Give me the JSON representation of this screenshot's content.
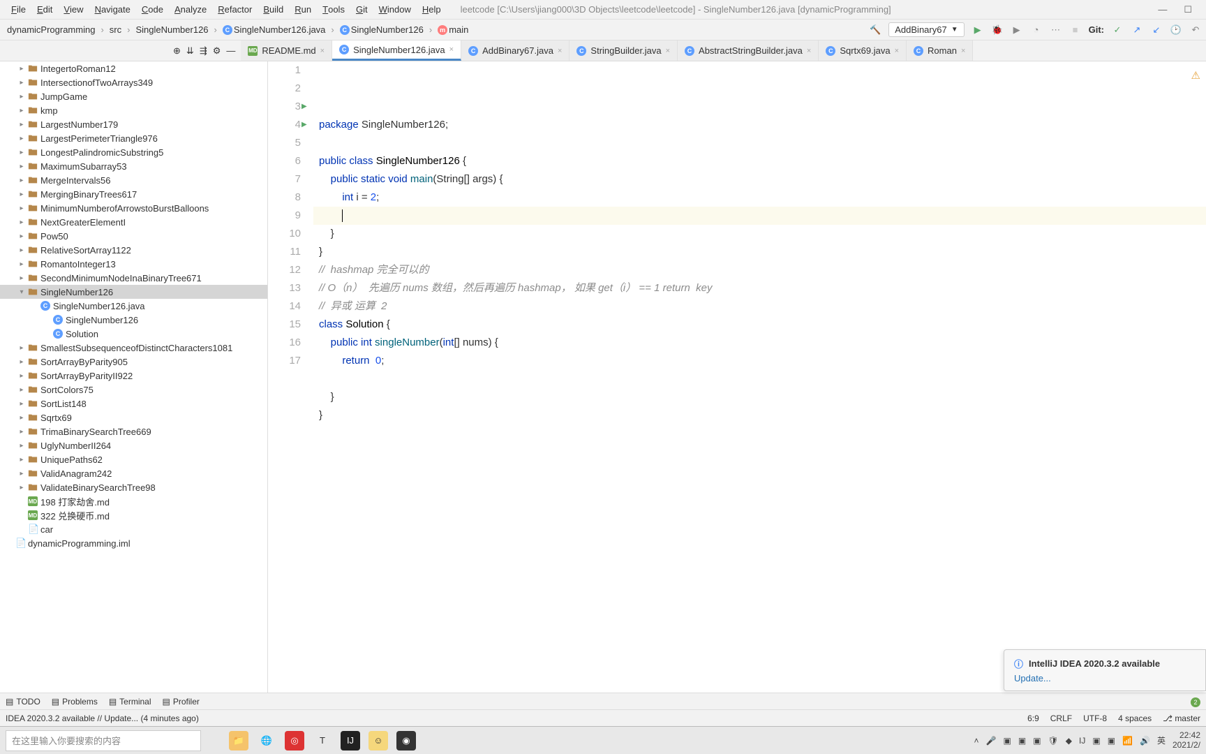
{
  "window": {
    "title": "leetcode [C:\\Users\\jiang000\\3D Objects\\leetcode\\leetcode] - SingleNumber126.java [dynamicProgramming]"
  },
  "menu": [
    "File",
    "Edit",
    "View",
    "Navigate",
    "Code",
    "Analyze",
    "Refactor",
    "Build",
    "Run",
    "Tools",
    "Git",
    "Window",
    "Help"
  ],
  "breadcrumb": [
    {
      "label": "dynamicProgramming",
      "icon": ""
    },
    {
      "label": "src",
      "icon": ""
    },
    {
      "label": "SingleNumber126",
      "icon": ""
    },
    {
      "label": "SingleNumber126.java",
      "icon": "c"
    },
    {
      "label": "SingleNumber126",
      "icon": "c"
    },
    {
      "label": "main",
      "icon": "m"
    }
  ],
  "run_config": "AddBinary67",
  "git_label": "Git:",
  "tabs": [
    {
      "label": "README.md",
      "icon": "md",
      "active": false
    },
    {
      "label": "SingleNumber126.java",
      "icon": "c",
      "active": true
    },
    {
      "label": "AddBinary67.java",
      "icon": "c",
      "active": false
    },
    {
      "label": "StringBuilder.java",
      "icon": "c",
      "active": false
    },
    {
      "label": "AbstractStringBuilder.java",
      "icon": "c",
      "active": false
    },
    {
      "label": "Sqrtx69.java",
      "icon": "c",
      "active": false
    },
    {
      "label": "Roman",
      "icon": "c",
      "active": false
    }
  ],
  "tree": [
    {
      "label": "IntegertoRoman12",
      "depth": 1,
      "icon": "fold"
    },
    {
      "label": "IntersectionofTwoArrays349",
      "depth": 1,
      "icon": "fold"
    },
    {
      "label": "JumpGame",
      "depth": 1,
      "icon": "fold"
    },
    {
      "label": "kmp",
      "depth": 1,
      "icon": "fold"
    },
    {
      "label": "LargestNumber179",
      "depth": 1,
      "icon": "fold"
    },
    {
      "label": "LargestPerimeterTriangle976",
      "depth": 1,
      "icon": "fold"
    },
    {
      "label": "LongestPalindromicSubstring5",
      "depth": 1,
      "icon": "fold"
    },
    {
      "label": "MaximumSubarray53",
      "depth": 1,
      "icon": "fold"
    },
    {
      "label": "MergeIntervals56",
      "depth": 1,
      "icon": "fold"
    },
    {
      "label": "MergingBinaryTrees617",
      "depth": 1,
      "icon": "fold"
    },
    {
      "label": "MinimumNumberofArrowstoBurstBalloons",
      "depth": 1,
      "icon": "fold"
    },
    {
      "label": "NextGreaterElementI",
      "depth": 1,
      "icon": "fold"
    },
    {
      "label": "Pow50",
      "depth": 1,
      "icon": "fold"
    },
    {
      "label": "RelativeSortArray1122",
      "depth": 1,
      "icon": "fold"
    },
    {
      "label": "RomantoInteger13",
      "depth": 1,
      "icon": "fold"
    },
    {
      "label": "SecondMinimumNodeInaBinaryTree671",
      "depth": 1,
      "icon": "fold"
    },
    {
      "label": "SingleNumber126",
      "depth": 1,
      "icon": "fold",
      "expanded": true,
      "selected": true
    },
    {
      "label": "SingleNumber126.java",
      "depth": 2,
      "icon": "j",
      "expanded": true
    },
    {
      "label": "SingleNumber126",
      "depth": 3,
      "icon": "c"
    },
    {
      "label": "Solution",
      "depth": 3,
      "icon": "c"
    },
    {
      "label": "SmallestSubsequenceofDistinctCharacters1081",
      "depth": 1,
      "icon": "fold"
    },
    {
      "label": "SortArrayByParity905",
      "depth": 1,
      "icon": "fold"
    },
    {
      "label": "SortArrayByParityII922",
      "depth": 1,
      "icon": "fold"
    },
    {
      "label": "SortColors75",
      "depth": 1,
      "icon": "fold"
    },
    {
      "label": "SortList148",
      "depth": 1,
      "icon": "fold"
    },
    {
      "label": "Sqrtx69",
      "depth": 1,
      "icon": "fold"
    },
    {
      "label": "TrimaBinarySearchTree669",
      "depth": 1,
      "icon": "fold"
    },
    {
      "label": "UglyNumberII264",
      "depth": 1,
      "icon": "fold"
    },
    {
      "label": "UniquePaths62",
      "depth": 1,
      "icon": "fold"
    },
    {
      "label": "ValidAnagram242",
      "depth": 1,
      "icon": "fold"
    },
    {
      "label": "ValidateBinarySearchTree98",
      "depth": 1,
      "icon": "fold"
    },
    {
      "label": "198 打家劫舍.md",
      "depth": 1,
      "icon": "md"
    },
    {
      "label": "322 兑换硬币.md",
      "depth": 1,
      "icon": "md"
    },
    {
      "label": "car",
      "depth": 1,
      "icon": "file"
    },
    {
      "label": "dynamicProgramming.iml",
      "depth": 0,
      "icon": "file"
    }
  ],
  "code": {
    "lines": [
      {
        "n": 1,
        "html": "<span class='kw'>package</span> SingleNumber126;"
      },
      {
        "n": 2,
        "html": ""
      },
      {
        "n": 3,
        "html": "<span class='kw'>public class</span> <span class='cls'>SingleNumber126</span> {",
        "run": true
      },
      {
        "n": 4,
        "html": "    <span class='kw'>public static void</span> <span class='mth'>main</span>(String[] args) {",
        "run": true
      },
      {
        "n": 5,
        "html": "        <span class='kw'>int</span> i = <span class='num'>2</span>;"
      },
      {
        "n": 6,
        "html": "        <span class='caret'></span>",
        "current": true
      },
      {
        "n": 7,
        "html": "    }"
      },
      {
        "n": 8,
        "html": "}"
      },
      {
        "n": 9,
        "html": "<span class='com'>//  hashmap 完全可以的</span>"
      },
      {
        "n": 10,
        "html": "<span class='com'>// O（n）  先遍历 nums 数组，然后再遍历 hashmap， 如果 get（i） == 1 return  key</span>"
      },
      {
        "n": 11,
        "html": "<span class='com'>//  异或 运算  2</span>"
      },
      {
        "n": 12,
        "html": "<span class='kw'>class</span> <span class='cls'>Solution</span> {"
      },
      {
        "n": 13,
        "html": "    <span class='kw'>public int</span> <span class='mth'>singleNumber</span>(<span class='kw'>int</span>[] nums) {"
      },
      {
        "n": 14,
        "html": "        <span class='kw'>return</span>  <span class='num'>0</span>;"
      },
      {
        "n": 15,
        "html": ""
      },
      {
        "n": 16,
        "html": "    }"
      },
      {
        "n": 17,
        "html": "}"
      }
    ]
  },
  "notification": {
    "title": "IntelliJ IDEA 2020.3.2 available",
    "link": "Update..."
  },
  "tools": [
    {
      "label": "TODO"
    },
    {
      "label": "Problems"
    },
    {
      "label": "Terminal"
    },
    {
      "label": "Profiler"
    }
  ],
  "tools_badge": "2",
  "status": {
    "left": "IDEA 2020.3.2 available // Update... (4 minutes ago)",
    "pos": "6:9",
    "sep": "CRLF",
    "enc": "UTF-8",
    "indent": "4 spaces",
    "branch": "master"
  },
  "taskbar": {
    "search_placeholder": "在这里输入你要搜索的内容",
    "ime": "英",
    "time": "22:42",
    "date": "2021/2/"
  }
}
